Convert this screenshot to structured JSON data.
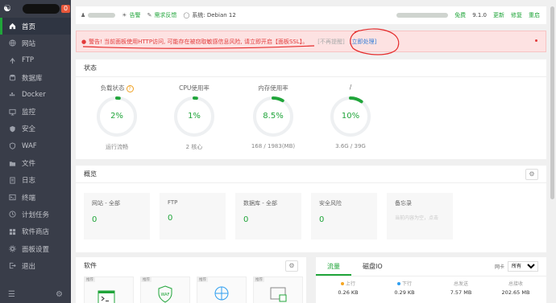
{
  "sidebar": {
    "badge": "0",
    "items": [
      {
        "label": "首页",
        "icon": "home-icon",
        "active": true
      },
      {
        "label": "网站",
        "icon": "globe-icon"
      },
      {
        "label": "FTP",
        "icon": "ftp-icon"
      },
      {
        "label": "数据库",
        "icon": "database-icon"
      },
      {
        "label": "Docker",
        "icon": "docker-icon"
      },
      {
        "label": "监控",
        "icon": "monitor-icon"
      },
      {
        "label": "安全",
        "icon": "shield-icon"
      },
      {
        "label": "WAF",
        "icon": "waf-icon"
      },
      {
        "label": "文件",
        "icon": "folder-icon"
      },
      {
        "label": "日志",
        "icon": "log-icon"
      },
      {
        "label": "终端",
        "icon": "terminal-icon"
      },
      {
        "label": "计划任务",
        "icon": "clock-icon"
      },
      {
        "label": "软件商店",
        "icon": "store-icon"
      },
      {
        "label": "面板设置",
        "icon": "settings-icon"
      },
      {
        "label": "退出",
        "icon": "logout-icon"
      }
    ]
  },
  "topbar": {
    "alert_label": "告警",
    "feedback_label": "需求反馈",
    "system_label": "系统: Debian 12",
    "free_label": "免费",
    "version": "9.1.0",
    "update_label": "更新",
    "repair_label": "修复",
    "restart_label": "重启"
  },
  "alert": {
    "text": "警告! 当前面板使用HTTP访问, 可能存在被窃取敏感信息风险, 请立即开启【面板SSL】。",
    "ignore_label": "[不再提醒]",
    "fix_label": "[立即处理]"
  },
  "status": {
    "title": "状态",
    "gauges": [
      {
        "label": "负载状态",
        "value": "2%",
        "percent": 2,
        "sub": "运行流畅",
        "help": "?"
      },
      {
        "label": "CPU使用率",
        "value": "1%",
        "percent": 1,
        "sub": "2 核心"
      },
      {
        "label": "内存使用率",
        "value": "8.5%",
        "percent": 8.5,
        "sub": "168 / 1983(MB)"
      },
      {
        "label": "/",
        "value": "10%",
        "percent": 10,
        "sub": "3.6G / 39G"
      }
    ]
  },
  "overview": {
    "title": "概览",
    "cards": [
      {
        "label": "网站 - 全部",
        "value": "0"
      },
      {
        "label": "FTP",
        "value": "0"
      },
      {
        "label": "数据库 - 全部",
        "value": "0"
      },
      {
        "label": "安全风险",
        "value": "0"
      }
    ],
    "memo": {
      "label": "备忘录",
      "placeholder": "当前内容为空，点击"
    }
  },
  "software": {
    "title": "软件",
    "tags": [
      "推荐",
      "推荐",
      "推荐",
      "推荐"
    ]
  },
  "traffic": {
    "tabs": [
      "流量",
      "磁盘IO"
    ],
    "nic_label": "网卡",
    "nic_value": "所有",
    "stats": [
      {
        "label": "上行",
        "value": "0.26 KB",
        "dot": "#f5a623"
      },
      {
        "label": "下行",
        "value": "0.29 KB",
        "dot": "#2f9ef0"
      },
      {
        "label": "总发送",
        "value": "7.57 MB"
      },
      {
        "label": "总接收",
        "value": "202.65 MB"
      }
    ]
  },
  "colors": {
    "accent": "#20a53a",
    "alert": "#e23a3a",
    "sidebar": "#393d49"
  }
}
